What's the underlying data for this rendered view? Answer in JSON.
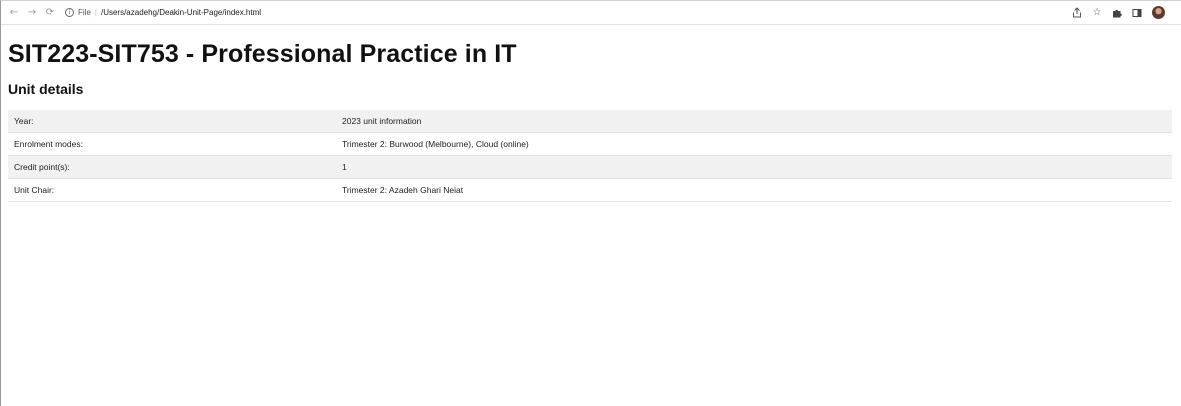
{
  "browser": {
    "url_scheme": "File",
    "url_path": "/Users/azadehg/Deakin-Unit-Page/index.html"
  },
  "page": {
    "title": "SIT223-SIT753 - Professional Practice in IT",
    "section_heading": "Unit details"
  },
  "unit_details": [
    {
      "label": "Year:",
      "value": "2023 unit information"
    },
    {
      "label": "Enrolment modes:",
      "value": "Trimester 2: Burwood (Melbourne), Cloud (online)"
    },
    {
      "label": "Credit point(s):",
      "value": "1"
    },
    {
      "label": "Unit Chair:",
      "value": "Trimester 2: Azadeh Ghari Neiat"
    }
  ],
  "icons": {
    "back": "arrow-left-icon",
    "forward": "arrow-right-icon",
    "reload": "reload-icon",
    "site_info": "info-icon",
    "share": "share-icon",
    "bookmark": "star-icon",
    "extensions": "puzzle-icon",
    "side_panel": "side-panel-icon",
    "profile": "avatar"
  }
}
